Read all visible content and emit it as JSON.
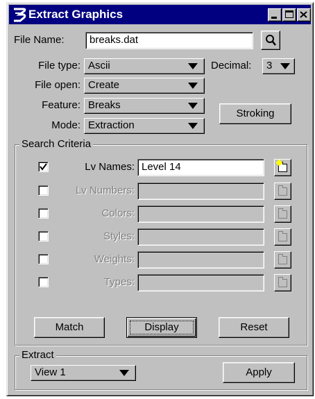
{
  "window": {
    "title": "Extract Graphics",
    "icon": "bentley-b-icon",
    "controls": [
      "minimize-icon",
      "maximize-icon",
      "close-icon"
    ]
  },
  "file": {
    "name_label": "File Name:",
    "name_value": "breaks.dat",
    "browse_icon": "search-icon"
  },
  "options": {
    "type_label": "File type:",
    "type_value": "Ascii",
    "decimal_label": "Decimal:",
    "decimal_value": "3",
    "open_label": "File open:",
    "open_value": "Create",
    "feature_label": "Feature:",
    "feature_value": "Breaks",
    "stroking_label": "Stroking",
    "mode_label": "Mode:",
    "mode_value": "Extraction"
  },
  "search": {
    "legend": "Search Criteria",
    "rows": [
      {
        "label": "Lv Names:",
        "value": "Level 14",
        "checked": true,
        "enabled": true
      },
      {
        "label": "Lv Numbers:",
        "value": "",
        "checked": false,
        "enabled": false
      },
      {
        "label": "Colors:",
        "value": "",
        "checked": false,
        "enabled": false
      },
      {
        "label": "Styles:",
        "value": "",
        "checked": false,
        "enabled": false
      },
      {
        "label": "Weights:",
        "value": "",
        "checked": false,
        "enabled": false
      },
      {
        "label": "Types:",
        "value": "",
        "checked": false,
        "enabled": false
      }
    ],
    "match_label": "Match",
    "display_label": "Display",
    "reset_label": "Reset"
  },
  "extract": {
    "legend": "Extract",
    "view_value": "View 1",
    "apply_label": "Apply"
  },
  "colors": {
    "titlebar": "#000080",
    "face": "#c0c0c0",
    "disabled_text": "#808080"
  }
}
